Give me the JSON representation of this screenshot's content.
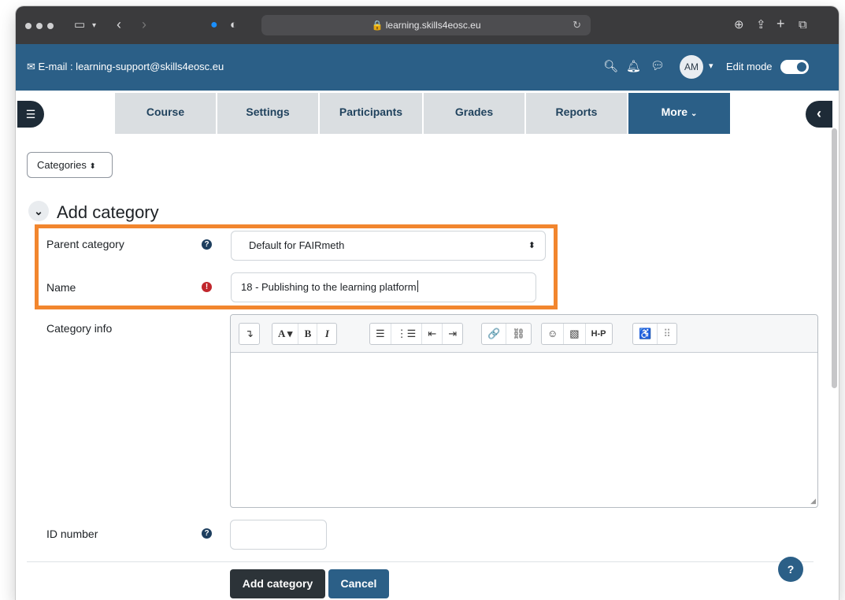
{
  "browser": {
    "url": "learning.skills4eosc.eu"
  },
  "navbar": {
    "support_email": "E-mail : learning-support@skills4eosc.eu",
    "avatar_initials": "AM",
    "edit_mode_label": "Edit mode",
    "edit_mode_on": true
  },
  "tabs": [
    {
      "label": "Course",
      "active": false
    },
    {
      "label": "Settings",
      "active": false
    },
    {
      "label": "Participants",
      "active": false
    },
    {
      "label": "Grades",
      "active": false
    },
    {
      "label": "Reports",
      "active": false
    },
    {
      "label": "More",
      "active": true
    }
  ],
  "page": {
    "categories_select": "Categories",
    "section_title": "Add category"
  },
  "form": {
    "parent_category_label": "Parent category",
    "parent_category_value": "Default for FAIRmeth",
    "name_label": "Name",
    "name_value": "18 - Publishing to the learning platform",
    "category_info_label": "Category info",
    "id_number_label": "ID number",
    "id_number_value": ""
  },
  "editor_toolbar": {
    "groups": [
      [
        "↴"
      ],
      [
        "A ▾",
        "B",
        "I"
      ],
      [
        "☰",
        "⋮☰",
        "⇤",
        "⇥"
      ],
      [
        "🔗",
        "⛓"
      ],
      [
        "☺",
        "▧",
        "H-P"
      ],
      [
        "♿",
        "⠿"
      ]
    ]
  },
  "buttons": {
    "submit": "Add category",
    "cancel": "Cancel",
    "help": "?"
  },
  "colors": {
    "navbar": "#2b5f87",
    "highlight": "#f2862e",
    "primary_button": "#2c3338"
  }
}
